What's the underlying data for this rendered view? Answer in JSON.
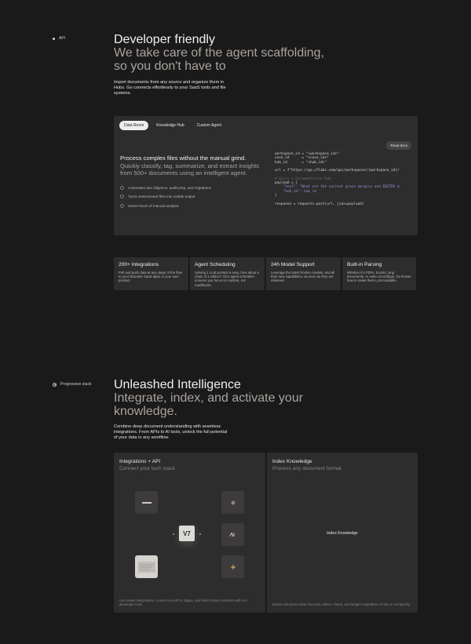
{
  "section1": {
    "tag": "API",
    "title": "Developer friendly",
    "subtitle_line1": "We take care of the agent scaffolding,",
    "subtitle_line2": "so you don't have to",
    "description": "Import documents from any source and organize them in Hubs. Go connects effortlessly to your SaaS tools and file systems."
  },
  "demo": {
    "tabs": [
      "Data Room",
      "Knowledge Hub",
      "Custom Agent"
    ],
    "heading": "Process complex files without the manual grind.",
    "subheading": "Quickly classify, tag, summarize, and extract insights from 500+ documents using an intelligent agent.",
    "checks": [
      "Automates due diligence, audit prep, and migrations",
      "Turns unstructured files into usable output",
      "Saves hours of manual analysis"
    ],
    "read_docs": "Read docs",
    "code_lines": [
      "workspace_id = \"<workspace_id>\"",
      "case_id      = \"<case_id>\"",
      "hub_id       = \"<hub_id>\"",
      "",
      "url = f\"https://go.v7labs.com/api/workspaces/{workspace_id}/",
      "",
      "# Query a Documentation Hub",
      "payload = {",
      "    \"text\": \"What are the current gross margins and EBITDA m",
      "    \"hub_id\": hub_id",
      "}",
      "",
      "response = requests.post(url, json=payload)"
    ]
  },
  "features": [
    {
      "title": "200+ Integrations",
      "text": "Pull and push data at any stage of the flow to your favourite SaaS apps or your own product."
    },
    {
      "title": "Agent Scheduling",
      "text": "Solving 1 LLM prompt is easy, how about a chain of 1 million? Go's agent scheduler ensures you focus on runtime, not roadblocks."
    },
    {
      "title": "24h Model Support",
      "text": "Leverage the latest frontier models, and all their new capabilities, as soon as they are released."
    },
    {
      "title": "Built-in Parsing",
      "text": "Whether it's PDFs, Excels, long documents, or video recordings, Go knows how to make them LLM readable."
    }
  ],
  "section2": {
    "tag": "Progressive stack",
    "title": "Unleashed Intelligence",
    "subtitle_line1": "Integrate, index, and activate your",
    "subtitle_line2": "knowledge.",
    "description": "Combine deep document understanding with seamless integrations. From APIs to AI tools, unlock the full potential of your data in any workflow."
  },
  "integrations_card": {
    "title": "Integrations + API",
    "subtitle": "Connect your tech stack",
    "center_logo": "V7",
    "footer": "Use native integrations, connect via API or Zapier, and build custom solutions with our developer tools."
  },
  "index_card": {
    "title": "Index Knowledge",
    "subtitle": "Process any document format",
    "center_label": "Index Knowledge",
    "footer": "Extract structured data from text, tables, charts, and images regardless of size or complexity."
  }
}
